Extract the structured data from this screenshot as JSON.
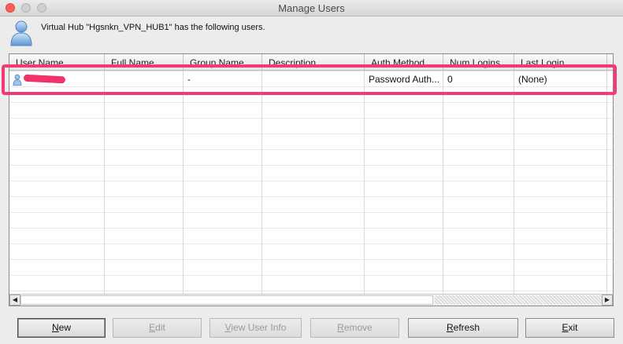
{
  "window": {
    "title": "Manage Users"
  },
  "header": {
    "message": "Virtual Hub \"Hgsnkn_VPN_HUB1\" has the following users."
  },
  "table": {
    "columns": [
      "User Name",
      "Full Name",
      "Group Name",
      "Description",
      "Auth Method",
      "Num Logins",
      "Last Login"
    ],
    "rows": [
      {
        "user_name": "",
        "full_name": "",
        "group_name": "-",
        "description": "",
        "auth_method": "Password Auth...",
        "num_logins": "0",
        "last_login": "(None)"
      }
    ]
  },
  "buttons": {
    "new": {
      "mnemonic": "N",
      "rest": "ew"
    },
    "edit": {
      "mnemonic": "E",
      "rest": "dit"
    },
    "view_user_info": {
      "mnemonic": "V",
      "rest": "iew User Info"
    },
    "remove": {
      "mnemonic": "R",
      "rest": "emove"
    },
    "refresh": {
      "mnemonic": "R",
      "rest": "efresh"
    },
    "exit": {
      "mnemonic": "E",
      "rest": "xit"
    }
  },
  "colors": {
    "highlight": "#f53a73",
    "redaction": "#f0336c"
  }
}
